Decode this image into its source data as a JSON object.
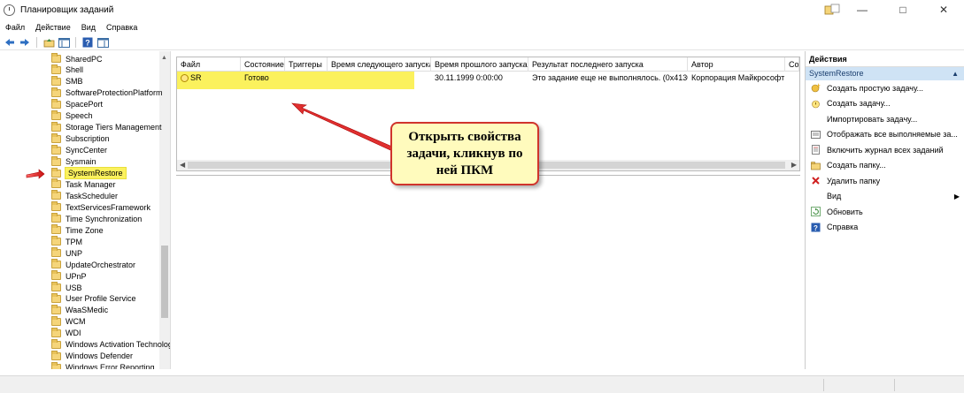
{
  "window": {
    "title": "Планировщик заданий"
  },
  "menu": [
    "Файл",
    "Действие",
    "Вид",
    "Справка"
  ],
  "tree": {
    "items": [
      "SharedPC",
      "Shell",
      "SMB",
      "SoftwareProtectionPlatform",
      "SpacePort",
      "Speech",
      "Storage Tiers Management",
      "Subscription",
      "SyncCenter",
      "Sysmain",
      "SystemRestore",
      "Task Manager",
      "TaskScheduler",
      "TextServicesFramework",
      "Time Synchronization",
      "Time Zone",
      "TPM",
      "UNP",
      "UpdateOrchestrator",
      "UPnP",
      "USB",
      "User Profile Service",
      "WaaSMedic",
      "WCM",
      "WDI",
      "Windows Activation Technologies",
      "Windows Defender",
      "Windows Error Reporting"
    ],
    "selected": "SystemRestore"
  },
  "tasks": {
    "columns": [
      "Файл",
      "Состояние",
      "Триггеры",
      "Время следующего запуска",
      "Время прошлого запуска",
      "Результат последнего запуска",
      "Автор",
      "Со"
    ],
    "rows": [
      {
        "name": "SR",
        "status": "Готово",
        "triggers": "",
        "next_run": "",
        "last_run": "30.11.1999 0:00:00",
        "last_result": "Это задание еще не выполнялось. (0x41303)",
        "author": "Корпорация Майкрософт"
      }
    ]
  },
  "actions": {
    "header": "Действия",
    "section": "SystemRestore",
    "items": [
      {
        "label": "Создать простую задачу...",
        "icon": "create-basic-task-icon"
      },
      {
        "label": "Создать задачу...",
        "icon": "create-task-icon"
      },
      {
        "label": "Импортировать задачу...",
        "icon": "none"
      },
      {
        "label": "Отображать все выполняемые за...",
        "icon": "running-tasks-icon"
      },
      {
        "label": "Включить журнал всех заданий",
        "icon": "history-icon"
      },
      {
        "label": "Создать папку...",
        "icon": "new-folder-icon"
      },
      {
        "label": "Удалить папку",
        "icon": "delete-icon"
      },
      {
        "label": "Вид",
        "icon": "none"
      },
      {
        "label": "Обновить",
        "icon": "refresh-icon"
      },
      {
        "label": "Справка",
        "icon": "help-icon"
      }
    ]
  },
  "callout": {
    "text": "Открыть свойства задачи, кликнув по ней ПКМ"
  },
  "colors": {
    "highlight": "#fbf15d",
    "arrow": "#e03030",
    "callout_border": "#d0342c",
    "callout_fill": "#fffbbd",
    "action_section": "#cfe3f5"
  }
}
